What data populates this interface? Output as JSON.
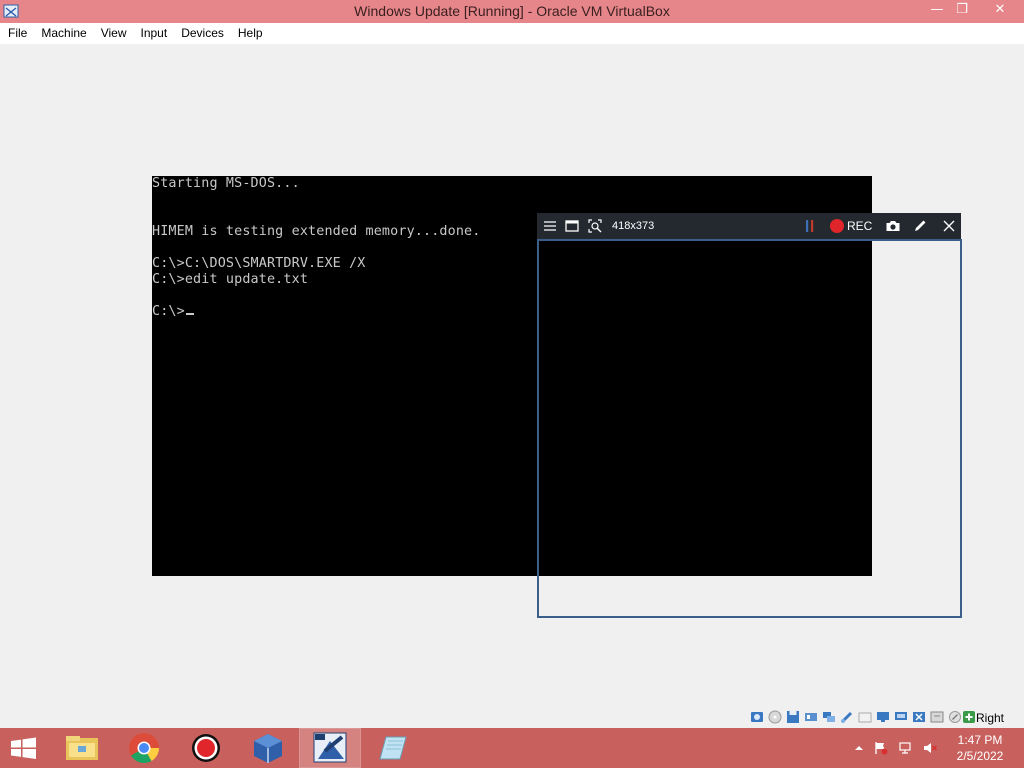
{
  "window": {
    "title": "Windows Update [Running] - Oracle VM VirtualBox",
    "minimize_glyph": "—",
    "restore_glyph": "❐",
    "close_glyph": "✕"
  },
  "menu": {
    "items": [
      "File",
      "Machine",
      "View",
      "Input",
      "Devices",
      "Help"
    ]
  },
  "vm_console": {
    "lines": [
      "Starting MS-DOS...",
      "HIMEM is testing extended memory...done.",
      "C:\\>C:\\DOS\\SMARTDRV.EXE /X",
      "C:\\>edit update.txt",
      "C:\\>"
    ]
  },
  "recorder": {
    "dimensions": "418x373",
    "rec_label": "REC",
    "icons": [
      "menu-icon",
      "window-icon",
      "region-zoom-icon",
      "pause-icon",
      "record-dot-icon",
      "camera-icon",
      "pencil-icon",
      "close-icon"
    ]
  },
  "statusbar": {
    "host_key": "Right Ctrl",
    "icons": [
      "hard-disk-icon",
      "optical-drive-icon",
      "floppy-icon",
      "audio-icon",
      "network-icon",
      "usb-icon",
      "shared-folders-icon",
      "display-icon",
      "video-capture-icon",
      "drag-drop-icon",
      "cpu-icon",
      "mouse-integration-icon",
      "keyboard-icon"
    ]
  },
  "taskbar": {
    "apps": [
      "file-explorer-icon",
      "chrome-icon",
      "screen-recorder-icon",
      "virtualbox-icon",
      "vm-window-icon",
      "notepad-icon"
    ],
    "active_app": "vm-window-icon",
    "tray": [
      "show-hidden-icons-chevron",
      "action-center-flag-icon",
      "network-icon",
      "volume-muted-icon"
    ],
    "time": "1:47 PM",
    "date": "2/5/2022"
  }
}
